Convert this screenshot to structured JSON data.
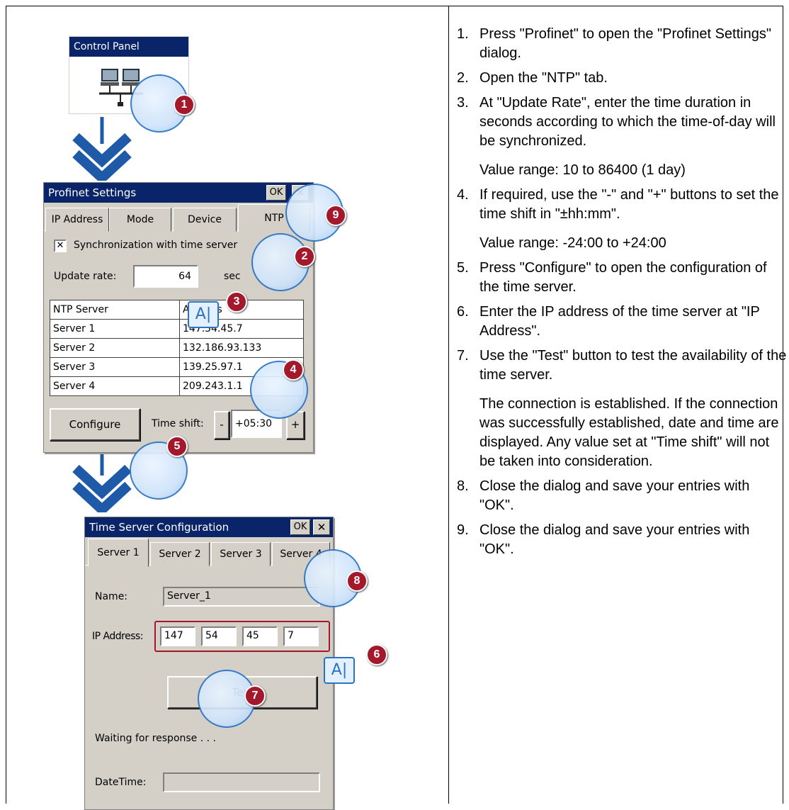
{
  "control_panel": {
    "title": "Control Panel"
  },
  "profinet": {
    "title": "Profinet Settings",
    "ok": "OK",
    "close": "✕",
    "tabs": [
      "IP Address",
      "Mode",
      "Device",
      "NTP"
    ],
    "sync_checkbox_mark": "✕",
    "sync_label": "Synchronization with time server",
    "update_rate_label": "Update rate:",
    "update_rate_value": "64",
    "update_rate_unit": "sec",
    "table_headers": [
      "NTP Server",
      "Address"
    ],
    "servers": [
      {
        "name": "Server 1",
        "address": "147.54.45.7"
      },
      {
        "name": "Server 2",
        "address": "132.186.93.133"
      },
      {
        "name": "Server 3",
        "address": "139.25.97.1"
      },
      {
        "name": "Server 4",
        "address": "209.243.1.1"
      }
    ],
    "configure_button": "Configure",
    "time_shift_label": "Time shift:",
    "minus": "-",
    "time_shift_value": "+05:30",
    "plus": "+"
  },
  "timeserver": {
    "title": "Time Server Configuration",
    "ok": "OK",
    "close": "✕",
    "tabs": [
      "Server 1",
      "Server 2",
      "Server 3",
      "Server 4"
    ],
    "name_label": "Name:",
    "name_value": "Server_1",
    "ip_label": "IP Address:",
    "ip_octets": [
      "147",
      "54",
      "45",
      "7"
    ],
    "test_button": "Test",
    "status_text": "Waiting for response . . .",
    "datetime_label": "DateTime:",
    "datetime_value": ""
  },
  "badges": [
    "1",
    "2",
    "3",
    "4",
    "5",
    "6",
    "7",
    "8",
    "9"
  ],
  "steps": [
    {
      "n": "1.",
      "text": "Press \"Profinet\" to open the \"Profinet Settings\" dialog."
    },
    {
      "n": "2.",
      "text": "Open the \"NTP\" tab."
    },
    {
      "n": "3.",
      "text": "At \"Update Rate\", enter the time duration in seconds according to which the time-of-day will be synchronized.",
      "note": "Value range: 10 to 86400 (1 day)"
    },
    {
      "n": "4.",
      "text": "If required, use the \"-\" and \"+\" buttons to set the time shift in \"±hh:mm\".",
      "note": "Value range: -24:00 to +24:00"
    },
    {
      "n": "5.",
      "text": "Press \"Configure\" to open the configuration of the time server."
    },
    {
      "n": "6.",
      "text": "Enter the IP address of the time server at \"IP Address\"."
    },
    {
      "n": "7.",
      "text": "Use the \"Test\" button to test the availability of the time server.",
      "note": "The connection is established. If the connection was successfully established, date and time are displayed. Any value set at \"Time shift\" will not be taken into consideration."
    },
    {
      "n": "8.",
      "text": "Close the dialog and save your entries with \"OK\"."
    },
    {
      "n": "9.",
      "text": "Close the dialog and save your entries with \"OK\"."
    }
  ],
  "colors": {
    "title_bar": "#0a246a",
    "dialog_face": "#d4d0c8",
    "badge": "#a4182c",
    "hand_outline": "#2b72c4"
  }
}
